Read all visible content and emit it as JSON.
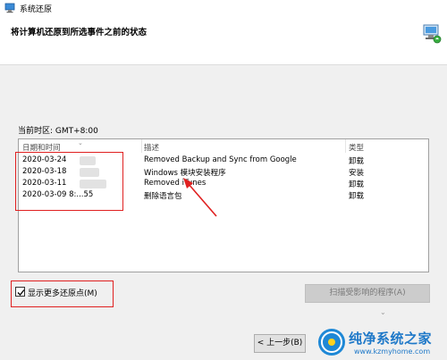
{
  "window": {
    "title": "系统还原"
  },
  "header": {
    "heading": "将计算机还原到所选事件之前的状态"
  },
  "timezone_label": "当前时区: GMT+8:00",
  "table": {
    "columns": [
      "日期和时间",
      "描述",
      "类型"
    ],
    "rows": [
      {
        "date": "2020-03-24",
        "description": "Removed Backup and Sync from Google",
        "type": "卸载"
      },
      {
        "date": "2020-03-18",
        "description": "Windows 模块安装程序",
        "type": "安装"
      },
      {
        "date": "2020-03-11",
        "description": "Removed iTunes",
        "type": "卸载"
      },
      {
        "date": "2020-03-09 8:...55",
        "description": "删除语言包",
        "type": "卸载"
      }
    ]
  },
  "show_more": {
    "label": "显示更多还原点(M)",
    "checked": true
  },
  "buttons": {
    "scan": "扫描受影响的程序(A)",
    "back": "< 上一步(B)"
  },
  "watermark": {
    "title": "纯净系统之家",
    "url": "www.kzmyhome.com"
  },
  "colors": {
    "highlight": "#e02020",
    "watermark": "#1e78c8"
  }
}
